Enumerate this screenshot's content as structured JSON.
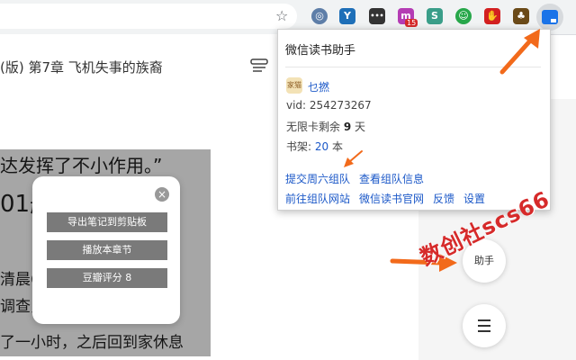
{
  "browser": {
    "star": "☆",
    "extensions": [
      {
        "name": "circle-icon",
        "color": "#5e7ea8",
        "glyph": "◎"
      },
      {
        "name": "v-icon",
        "color": "#1e6fb8",
        "glyph": "Y"
      },
      {
        "name": "dots-icon",
        "color": "#333333",
        "glyph": "•••"
      },
      {
        "name": "m-icon",
        "color": "#b43cb4",
        "glyph": "m"
      },
      {
        "name": "s-icon",
        "color": "#3a9e89",
        "glyph": "S"
      },
      {
        "name": "chat-icon",
        "color": "#27a74a",
        "glyph": "☺"
      },
      {
        "name": "stop-icon",
        "color": "#d32020",
        "glyph": "✋"
      },
      {
        "name": "plant-icon",
        "color": "#6b4a18",
        "glyph": "♣"
      }
    ],
    "badge": "15"
  },
  "reader": {
    "chapter_title": "(版)  第7章 飞机失事的族裔",
    "lines": [
      "达发挥了不小作用。”",
      "01航",
      "清晨6                          司8",
      "调查员                        中得",
      "了一小时，之后回到家休息"
    ]
  },
  "assistant_card": {
    "close": "×",
    "buttons": [
      "导出笔记到剪贴板",
      "播放本章节",
      "豆瓣评分 8"
    ]
  },
  "side_buttons": {
    "helper_label": "助手"
  },
  "popup": {
    "title": "微信读书助手",
    "avatar_text": "家猫",
    "user_name": "乜撚",
    "vid_label": "vid: ",
    "vid_value": "254273267",
    "days_label": "无限卡剩余 ",
    "days_value": "9",
    "days_unit": " 天",
    "shelf_label": "书架: ",
    "shelf_value": "20",
    "shelf_unit": " 本",
    "links_row1": [
      "提交周六组队",
      "查看组队信息"
    ],
    "links_row2": [
      "前往组队网站",
      "微信读书官网",
      "反馈",
      "设置"
    ]
  },
  "watermark": "数创社scs66",
  "colors": {
    "link": "#1b58c8",
    "arrow": "#f26a1b",
    "watermark": "#d62a2a"
  }
}
